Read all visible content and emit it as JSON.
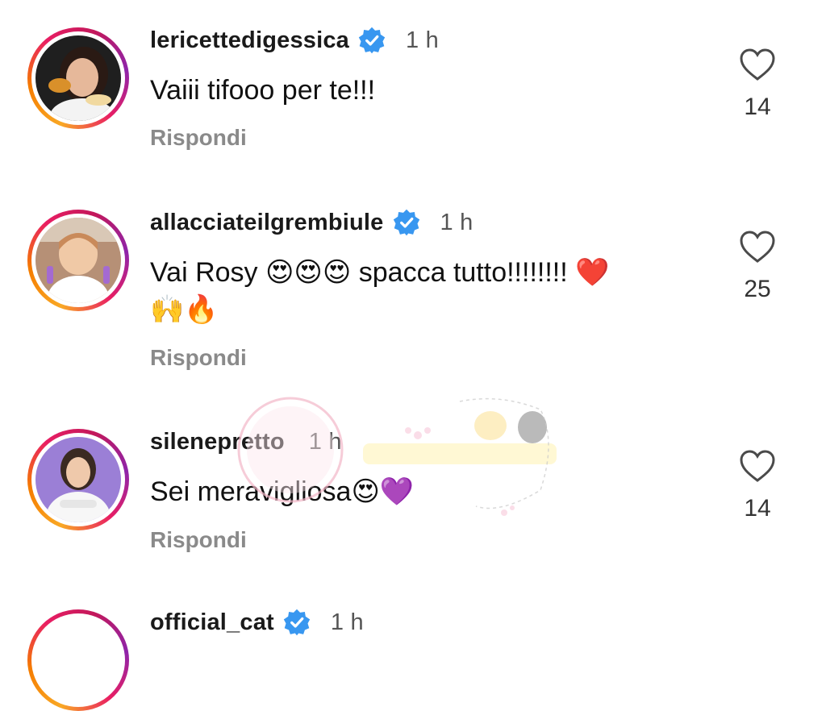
{
  "comments": [
    {
      "username": "lericettedigessica",
      "verified": true,
      "time": "1 h",
      "text": "Vaiii tifooo per te!!!",
      "emojis": "",
      "emojis_line2": "",
      "reply_label": "Rispondi",
      "likes": "14",
      "avatar": "woman-with-food-avatar"
    },
    {
      "username": "allacciateilgrembiule",
      "verified": true,
      "time": "1 h",
      "text": "Vai Rosy ",
      "emojis": "😍😍😍",
      "text_after": " spacca tutto!!!!!!!! ",
      "emoji_end": "❤️",
      "emojis_line2": "🙌🔥",
      "reply_label": "Rispondi",
      "likes": "25",
      "avatar": "woman-in-kitchen-avatar"
    },
    {
      "username": "silenepretto",
      "verified": false,
      "time": "1 h",
      "text": "Sei meravigliosa",
      "emojis": "😍💜",
      "emojis_line2": "",
      "reply_label": "Rispondi",
      "likes": "14",
      "avatar": "woman-in-white-avatar"
    },
    {
      "username": "official_cat",
      "verified": true,
      "time": "1 h",
      "partial": true
    }
  ],
  "colors": {
    "verified": "#3897f0",
    "ring_start": "#f9a825",
    "ring_end": "#c2185b",
    "reply": "#8a8a8a"
  },
  "icons": {
    "like": "heart-outline-icon",
    "verified": "verified-badge-icon"
  }
}
